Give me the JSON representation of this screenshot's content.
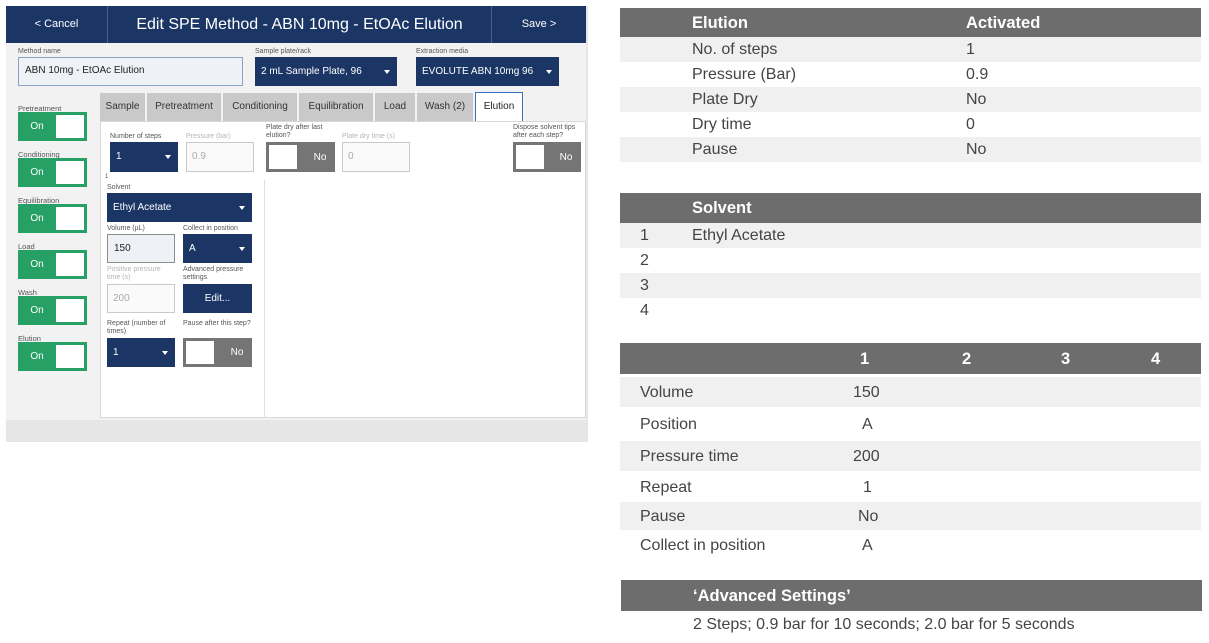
{
  "app": {
    "cancel_label": "< Cancel",
    "title": "Edit SPE Method - ABN 10mg - EtOAc Elution",
    "save_label": "Save >",
    "method_name_label": "Method name",
    "method_name_value": "ABN 10mg - EtOAc Elution",
    "plate_label": "Sample plate/rack",
    "plate_value": "2 mL Sample Plate, 96",
    "media_label": "Extraction media",
    "media_value": "EVOLUTE ABN 10mg 96",
    "stages": [
      {
        "label": "Pretreatment",
        "toggle": "On"
      },
      {
        "label": "Conditioning",
        "toggle": "On"
      },
      {
        "label": "Equilibration",
        "toggle": "On"
      },
      {
        "label": "Load",
        "toggle": "On"
      },
      {
        "label": "Wash",
        "toggle": "On"
      },
      {
        "label": "Elution",
        "toggle": "On"
      }
    ],
    "tabs": [
      "Sample",
      "Pretreatment",
      "Conditioning",
      "Equilibration",
      "Load",
      "Wash (2)",
      "Elution"
    ],
    "active_tab": "Elution",
    "num_steps_label": "Number of steps",
    "num_steps_value": "1",
    "pressure_label": "Pressure (bar)",
    "pressure_value": "0.9",
    "plate_dry_label": "Plate dry after last elution?",
    "plate_dry_toggle": "No",
    "dry_time_label": "Plate dry time (s)",
    "dry_time_value": "0",
    "dispose_label": "Dispose solvent tips after each step?",
    "dispose_toggle": "No",
    "step_marker": "1",
    "solvent_label": "Solvent",
    "solvent_value": "Ethyl Acetate",
    "volume_label": "Volume (µL)",
    "volume_value": "150",
    "collect_label": "Collect in position",
    "collect_value": "A",
    "pos_pressure_label": "Positive pressure time (s)",
    "pos_pressure_value": "200",
    "adv_pressure_label": "Advanced pressure settings",
    "edit_label": "Edit...",
    "repeat_label": "Repeat (number of times)",
    "repeat_value": "1",
    "pause_label": "Pause after this step?",
    "pause_toggle": "No"
  },
  "summary": {
    "elution": {
      "header": [
        "Elution",
        "Activated"
      ],
      "rows": [
        [
          "No. of steps",
          "1"
        ],
        [
          "Pressure (Bar)",
          "0.9"
        ],
        [
          "Plate Dry",
          "No"
        ],
        [
          "Dry time",
          "0"
        ],
        [
          "Pause",
          "No"
        ]
      ]
    },
    "solvent": {
      "header": "Solvent",
      "rows": [
        [
          "1",
          "Ethyl Acetate"
        ],
        [
          "2",
          ""
        ],
        [
          "3",
          ""
        ],
        [
          "4",
          ""
        ]
      ]
    },
    "steps": {
      "header": [
        "1",
        "2",
        "3",
        "4"
      ],
      "rows": [
        [
          "Volume",
          "150"
        ],
        [
          "Position",
          "A"
        ],
        [
          "Pressure time",
          "200"
        ],
        [
          "Repeat",
          "1"
        ],
        [
          "Pause",
          "No"
        ],
        [
          "Collect in position",
          "A"
        ]
      ]
    },
    "advanced": {
      "header": "‘Advanced Settings’",
      "text": "2 Steps; 0.9 bar for 10 seconds;  2.0 bar for 5 seconds"
    }
  }
}
